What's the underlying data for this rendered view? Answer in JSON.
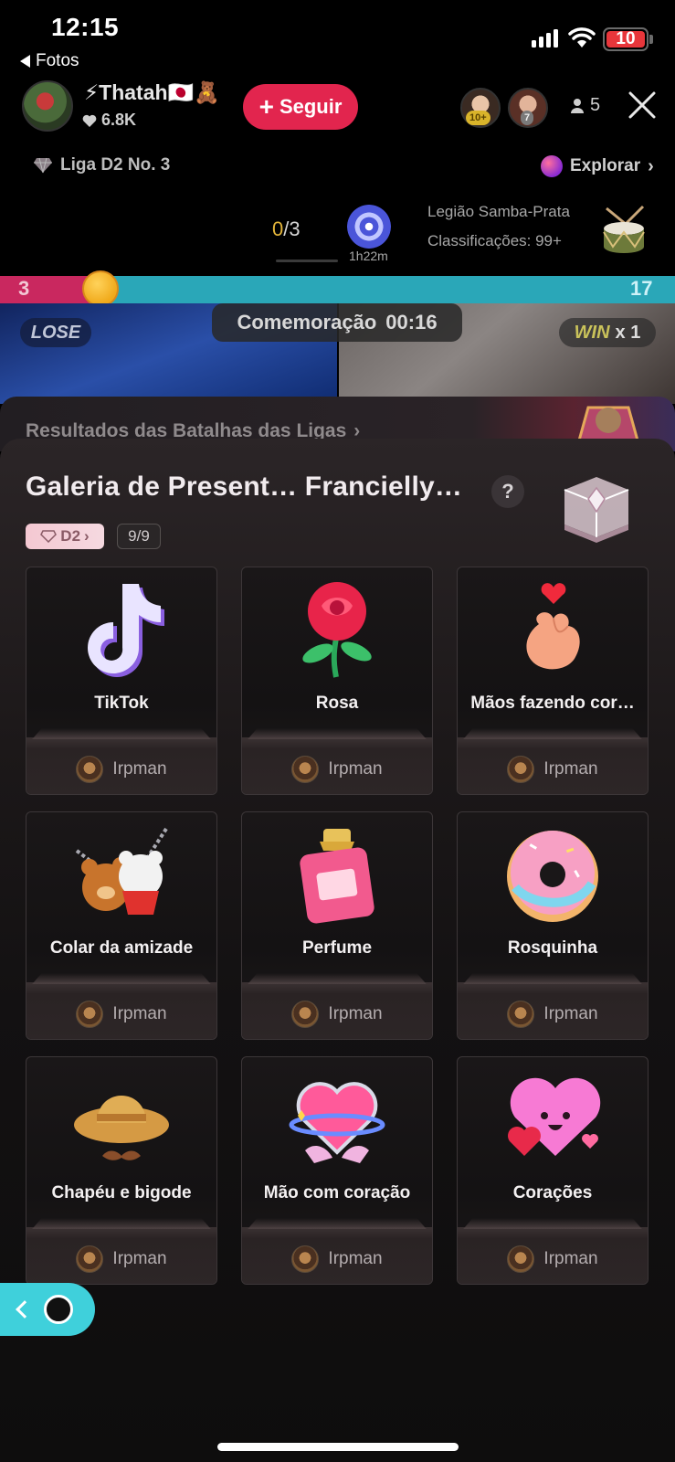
{
  "status_bar": {
    "time": "12:15",
    "back_label": "Fotos",
    "battery_level": "10",
    "battery_color": "#e8363b"
  },
  "host": {
    "name": "⚡Thatah🇯🇵🧸",
    "likes": "6.8K",
    "follow_label": "Seguir",
    "follow_color": "#e2254e"
  },
  "viewers": {
    "badges": [
      "10+",
      "7"
    ],
    "count": "5"
  },
  "league": {
    "label": "Liga D2 No. 3",
    "explore_label": "Explorar"
  },
  "task": {
    "done": "0",
    "total": "/3",
    "timer": "1h22m",
    "legion_name": "Legião Samba-Prata",
    "legion_rank": "Classificações: 99+"
  },
  "battle": {
    "score_left": "3",
    "score_right": "17",
    "lose_label": "LOSE",
    "win_label": "WIN",
    "win_multiplier": "x 1",
    "celebration_label": "Comemoração",
    "celebration_timer": "00:16",
    "results_label": "Resultados das Batalhas das Ligas"
  },
  "gallery": {
    "title": "Galeria de Present… Francielly…",
    "help": "?",
    "rank_badge": "D2",
    "count": "9/9",
    "accent": "#3fd0db",
    "gifts": [
      {
        "name": "TikTok",
        "sender": "Irpman",
        "icon": "tiktok-logo-icon"
      },
      {
        "name": "Rosa",
        "sender": "Irpman",
        "icon": "rose-icon"
      },
      {
        "name": "Mãos fazendo cor…",
        "sender": "Irpman",
        "icon": "finger-heart-icon"
      },
      {
        "name": "Colar da amizade",
        "sender": "Irpman",
        "icon": "bears-necklace-icon"
      },
      {
        "name": "Perfume",
        "sender": "Irpman",
        "icon": "perfume-bottle-icon"
      },
      {
        "name": "Rosquinha",
        "sender": "Irpman",
        "icon": "donut-icon"
      },
      {
        "name": "Chapéu e bigode",
        "sender": "Irpman",
        "icon": "hat-mustache-icon"
      },
      {
        "name": "Mão com coração",
        "sender": "Irpman",
        "icon": "hand-heart-icon"
      },
      {
        "name": "Corações",
        "sender": "Irpman",
        "icon": "hearts-icon"
      }
    ]
  }
}
